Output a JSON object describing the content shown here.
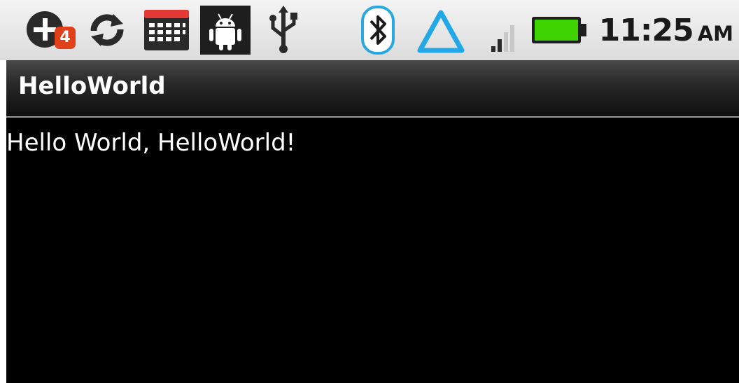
{
  "status_bar": {
    "notification_count": "4",
    "time": "11:25",
    "ampm": "AM",
    "icons": [
      "add-notification-icon",
      "sync-icon",
      "calendar-icon",
      "android-debug-icon",
      "usb-icon",
      "bluetooth-icon",
      "triangle-alert-icon",
      "signal-strength-icon",
      "battery-icon"
    ],
    "colors": {
      "badge": "#e0401a",
      "bluetooth": "#2aa8e0",
      "battery_fill": "#3fd400",
      "triangle": "#22a8e6"
    }
  },
  "app": {
    "title": "HelloWorld",
    "content_text": "Hello World, HelloWorld!"
  }
}
